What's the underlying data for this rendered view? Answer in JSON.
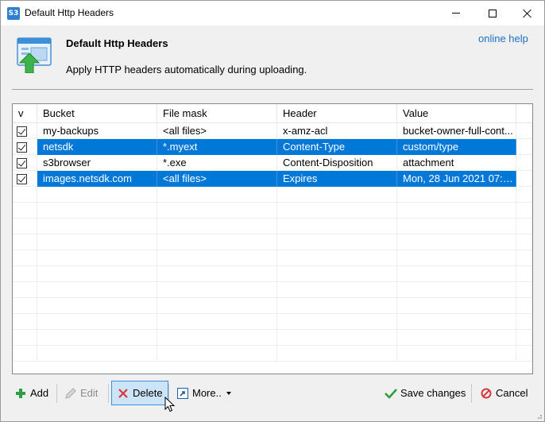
{
  "window": {
    "title": "Default Http Headers",
    "app_icon_text": "S3"
  },
  "header": {
    "title": "Default Http Headers",
    "description": "Apply HTTP headers automatically during uploading.",
    "help_link": "online help"
  },
  "grid": {
    "columns": [
      "v",
      "Bucket",
      "File mask",
      "Header",
      "Value"
    ],
    "rows": [
      {
        "checked": true,
        "selected": false,
        "bucket": "my-backups",
        "mask": "<all files>",
        "header": "x-amz-acl",
        "value": "bucket-owner-full-cont..."
      },
      {
        "checked": true,
        "selected": true,
        "bucket": "netsdk",
        "mask": "*.myext",
        "header": "Content-Type",
        "value": "custom/type"
      },
      {
        "checked": true,
        "selected": false,
        "bucket": "s3browser",
        "mask": "*.exe",
        "header": "Content-Disposition",
        "value": "attachment"
      },
      {
        "checked": true,
        "selected": true,
        "bucket": "images.netsdk.com",
        "mask": "<all files>",
        "header": "Expires",
        "value": "Mon, 28 Jun 2021 07:4..."
      }
    ]
  },
  "toolbar": {
    "add_label": "Add",
    "edit_label": "Edit",
    "delete_label": "Delete",
    "more_label": "More..",
    "save_label": "Save changes",
    "cancel_label": "Cancel"
  },
  "colors": {
    "selection": "#0078d7",
    "link": "#1f6fc5",
    "add_green": "#2ea043",
    "delete_red": "#d9363e",
    "save_green": "#2ea043",
    "cancel_red": "#d9363e"
  },
  "icons": {
    "header": "upload-web-icon",
    "add": "plus-icon",
    "edit": "pencil-icon",
    "delete": "x-icon",
    "more": "shortcut-arrow-icon",
    "save": "checkmark-icon",
    "cancel": "no-entry-icon"
  }
}
